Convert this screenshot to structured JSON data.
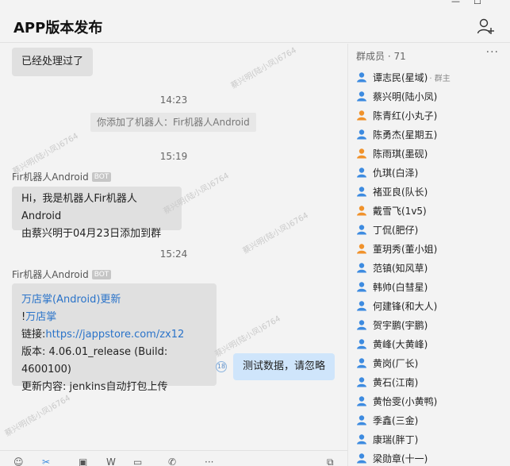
{
  "window": {
    "minimize": "—",
    "maximize": "☐"
  },
  "header": {
    "title": "APP版本发布"
  },
  "chat": {
    "msg_top": "已经处理过了",
    "time1": "14:23",
    "system_notice": "你添加了机器人：Fir机器人Android",
    "time2": "15:19",
    "sender1": "Fir机器人Android",
    "bot_tag": "BOT",
    "bot_msg1_line1": "Hi，我是机器人Fir机器人Android",
    "bot_msg1_line2": "由蔡兴明于04月23日添加到群",
    "time3": "15:24",
    "sender2": "Fir机器人Android",
    "bot_msg2": {
      "link_title": "万店掌(Android)更新",
      "excl": "!",
      "brand": "万店掌",
      "link_label": "链接:",
      "link_url": "https://jappstore.com/zx12",
      "version": "版本: 4.06.01_release (Build: 4600100)",
      "content": "更新内容: jenkins自动打包上传"
    },
    "my_msg": "测试数据，请忽略",
    "read_count": "18",
    "watermark": "蔡兴明(陆小凤)6764"
  },
  "members": {
    "header": "群成员 · 71",
    "more": "···",
    "list": [
      {
        "name": "谭志民(星域)",
        "role": "· 群主",
        "color": "#3d8be0"
      },
      {
        "name": "蔡兴明(陆小凤)",
        "role": "",
        "color": "#3d8be0"
      },
      {
        "name": "陈青红(小丸子)",
        "role": "",
        "color": "#f0922b"
      },
      {
        "name": "陈勇杰(星期五)",
        "role": "",
        "color": "#3d8be0"
      },
      {
        "name": "陈雨琪(墨砚)",
        "role": "",
        "color": "#f0922b"
      },
      {
        "name": "仇琪(白泽)",
        "role": "",
        "color": "#3d8be0"
      },
      {
        "name": "褚亚良(队长)",
        "role": "",
        "color": "#3d8be0"
      },
      {
        "name": "戴雪飞(1v5)",
        "role": "",
        "color": "#f0922b"
      },
      {
        "name": "丁侃(肥仔)",
        "role": "",
        "color": "#3d8be0"
      },
      {
        "name": "董玥秀(董小姐)",
        "role": "",
        "color": "#f0922b"
      },
      {
        "name": "范镇(知风草)",
        "role": "",
        "color": "#3d8be0"
      },
      {
        "name": "韩帅(白彗星)",
        "role": "",
        "color": "#3d8be0"
      },
      {
        "name": "何建锋(和大人)",
        "role": "",
        "color": "#3d8be0"
      },
      {
        "name": "贺宇鹏(宇鹏)",
        "role": "",
        "color": "#3d8be0"
      },
      {
        "name": "黄峰(大黄峰)",
        "role": "",
        "color": "#3d8be0"
      },
      {
        "name": "黄岗(厂长)",
        "role": "",
        "color": "#3d8be0"
      },
      {
        "name": "黄石(江南)",
        "role": "",
        "color": "#3d8be0"
      },
      {
        "name": "黄怡雯(小黄鸭)",
        "role": "",
        "color": "#3d8be0"
      },
      {
        "name": "季鑫(三金)",
        "role": "",
        "color": "#3d8be0"
      },
      {
        "name": "康瑞(胖丁)",
        "role": "",
        "color": "#3d8be0"
      },
      {
        "name": "梁勋章(十一)",
        "role": "",
        "color": "#3d8be0"
      }
    ]
  },
  "toolbar": {
    "emoji": "☺",
    "scissors": "✂",
    "image": "▣",
    "doc": "W",
    "folder": "▭",
    "phone": "✆",
    "more": "···",
    "history": "⧉"
  }
}
